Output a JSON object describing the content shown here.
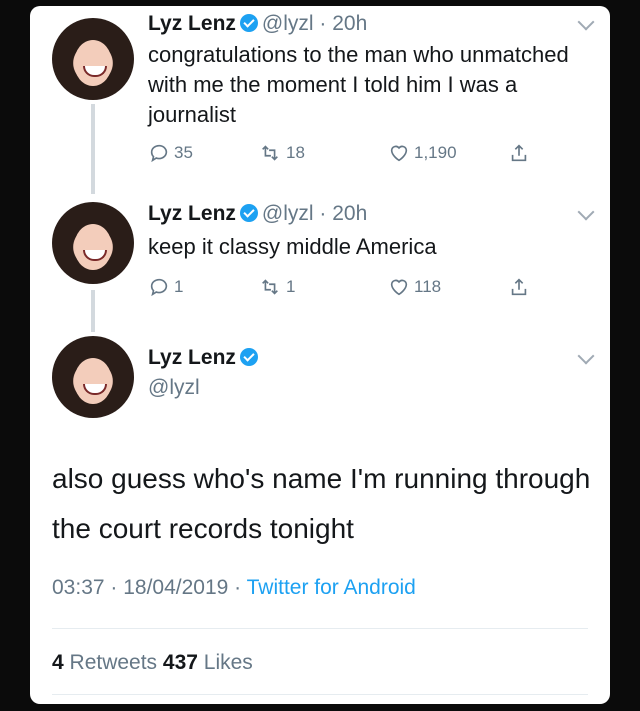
{
  "tweets": [
    {
      "name": "Lyz Lenz",
      "handle": "@lyzl",
      "sep": " · ",
      "time": "20h",
      "text": "congratulations to the man who unmatched with me the moment I told him I was a journalist",
      "replies": "35",
      "retweets": "18",
      "likes": "1,190"
    },
    {
      "name": "Lyz Lenz",
      "handle": "@lyzl",
      "sep": " · ",
      "time": "20h",
      "text": "keep it classy middle America",
      "replies": "1",
      "retweets": "1",
      "likes": "118"
    }
  ],
  "main": {
    "name": "Lyz Lenz",
    "handle": "@lyzl",
    "text": "also guess who's name I'm running through the court records tonight",
    "timestamp": "03:37 · 18/04/2019 · ",
    "source": "Twitter for Android",
    "retweets_count": "4",
    "retweets_label": " Retweets  ",
    "likes_count": "437",
    "likes_label": " Likes"
  },
  "icons": {
    "reply": "reply-icon",
    "retweet": "retweet-icon",
    "like": "heart-icon",
    "share": "share-icon",
    "verified": "verified-badge-icon",
    "more": "chevron-down-icon"
  },
  "colors": {
    "accent": "#1da1f2",
    "muted": "#657786",
    "text": "#14171a"
  }
}
